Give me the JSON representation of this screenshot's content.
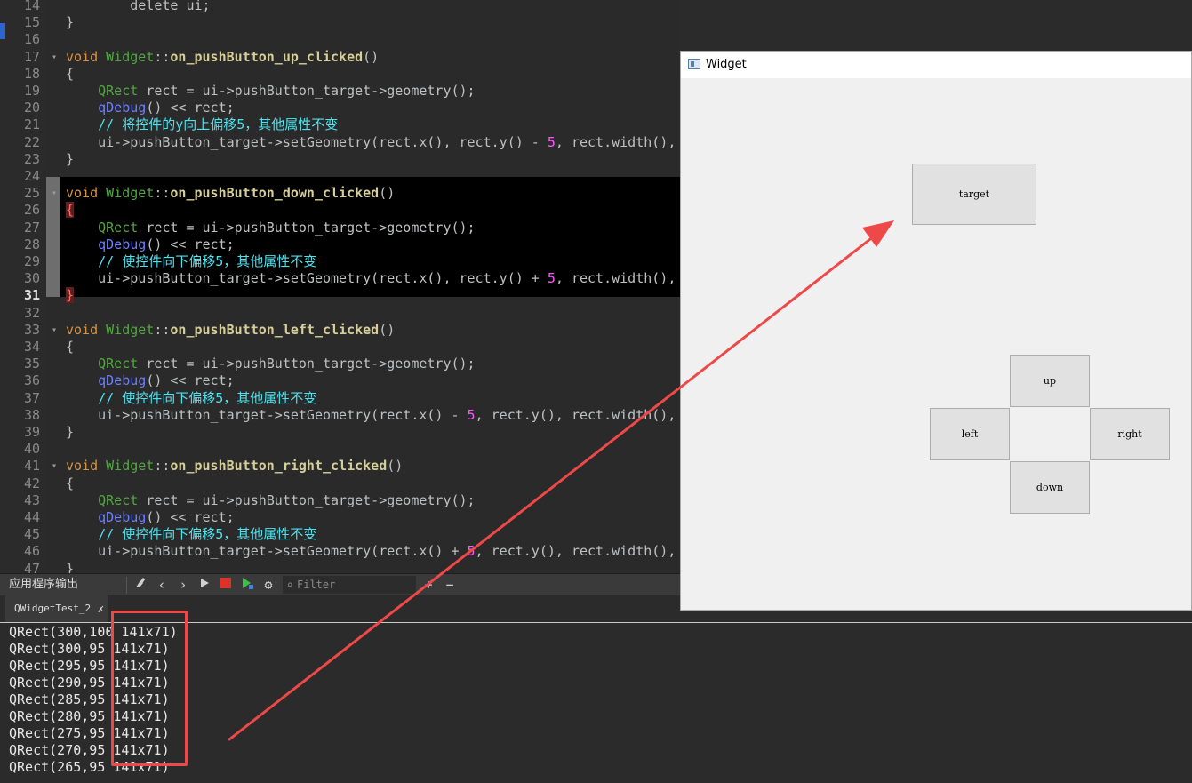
{
  "editor": {
    "lines": [
      {
        "n": "14",
        "fold": "",
        "html": "        <span class='pl'>delete ui;</span>"
      },
      {
        "n": "15",
        "fold": "",
        "html": "<span class='pl'>}</span>"
      },
      {
        "n": "16",
        "fold": "",
        "html": ""
      },
      {
        "n": "17",
        "fold": "▾",
        "html": "<span class='kw'>void</span> <span class='cls'>Widget</span><span class='pl'>::</span><span class='fn'>on_pushButton_up_clicked</span><span class='pl'>()</span>"
      },
      {
        "n": "18",
        "fold": "",
        "html": "<span class='pl'>{</span>"
      },
      {
        "n": "19",
        "fold": "",
        "html": "    <span class='type'>QRect</span> <span class='pl'>rect = ui-&gt;pushButton_target-&gt;geometry();</span>"
      },
      {
        "n": "20",
        "fold": "",
        "html": "    <span class='qd'>qDebug</span><span class='pl'>() &lt;&lt; rect;</span>"
      },
      {
        "n": "21",
        "fold": "",
        "html": "    <span class='cm'>// 将控件的y向上偏移5，其他属性不变</span>"
      },
      {
        "n": "22",
        "fold": "",
        "html": "    <span class='pl'>ui-&gt;pushButton_target-&gt;setGeometry(rect.x(), rect.y() - </span><span class='num'>5</span><span class='pl'>, rect.width(),</span>"
      },
      {
        "n": "23",
        "fold": "",
        "html": "<span class='pl'>}</span>"
      },
      {
        "n": "24",
        "fold": "",
        "html": ""
      },
      {
        "n": "25",
        "fold": "▾",
        "html": "<span class='kw'>void</span> <span class='cls'>Widget</span><span class='pl'>::</span><span class='fn'>on_pushButton_down_clicked</span><span class='pl'>()</span>"
      },
      {
        "n": "26",
        "fold": "",
        "html": "<span class='br-hl'>{</span>"
      },
      {
        "n": "27",
        "fold": "",
        "html": "    <span class='type'>QRect</span> <span class='pl'>rect = ui-&gt;pushButton_target-&gt;geometry();</span>"
      },
      {
        "n": "28",
        "fold": "",
        "html": "    <span class='qd'>qDebug</span><span class='pl'>() &lt;&lt; rect;</span>"
      },
      {
        "n": "29",
        "fold": "",
        "html": "    <span class='cm'>// 使控件向下偏移5，其他属性不变</span>"
      },
      {
        "n": "30",
        "fold": "",
        "html": "    <span class='pl'>ui-&gt;pushButton_target-&gt;setGeometry(rect.x(), rect.y() + </span><span class='num'>5</span><span class='pl'>, rect.width(),</span>"
      },
      {
        "n": "31",
        "fold": "",
        "cur": true,
        "html": "<span class='br-hl'>}</span>"
      },
      {
        "n": "32",
        "fold": "",
        "html": ""
      },
      {
        "n": "33",
        "fold": "▾",
        "html": "<span class='kw'>void</span> <span class='cls'>Widget</span><span class='pl'>::</span><span class='fn'>on_pushButton_left_clicked</span><span class='pl'>()</span>"
      },
      {
        "n": "34",
        "fold": "",
        "html": "<span class='pl'>{</span>"
      },
      {
        "n": "35",
        "fold": "",
        "html": "    <span class='type'>QRect</span> <span class='pl'>rect = ui-&gt;pushButton_target-&gt;geometry();</span>"
      },
      {
        "n": "36",
        "fold": "",
        "html": "    <span class='qd'>qDebug</span><span class='pl'>() &lt;&lt; rect;</span>"
      },
      {
        "n": "37",
        "fold": "",
        "html": "    <span class='cm'>// 使控件向下偏移5，其他属性不变</span>"
      },
      {
        "n": "38",
        "fold": "",
        "html": "    <span class='pl'>ui-&gt;pushButton_target-&gt;setGeometry(rect.x() - </span><span class='num'>5</span><span class='pl'>, rect.y(), rect.width(),</span>"
      },
      {
        "n": "39",
        "fold": "",
        "html": "<span class='pl'>}</span>"
      },
      {
        "n": "40",
        "fold": "",
        "html": ""
      },
      {
        "n": "41",
        "fold": "▾",
        "html": "<span class='kw'>void</span> <span class='cls'>Widget</span><span class='pl'>::</span><span class='fn'>on_pushButton_right_clicked</span><span class='pl'>()</span>"
      },
      {
        "n": "42",
        "fold": "",
        "html": "<span class='pl'>{</span>"
      },
      {
        "n": "43",
        "fold": "",
        "html": "    <span class='type'>QRect</span> <span class='pl'>rect = ui-&gt;pushButton_target-&gt;geometry();</span>"
      },
      {
        "n": "44",
        "fold": "",
        "html": "    <span class='qd'>qDebug</span><span class='pl'>() &lt;&lt; rect;</span>"
      },
      {
        "n": "45",
        "fold": "",
        "html": "    <span class='cm'>// 使控件向下偏移5，其他属性不变</span>"
      },
      {
        "n": "46",
        "fold": "",
        "html": "    <span class='pl'>ui-&gt;pushButton_target-&gt;setGeometry(rect.x() + </span><span class='num'>5</span><span class='pl'>, rect.y(), rect.width(),</span>"
      },
      {
        "n": "47",
        "fold": "",
        "html": "<span class='pl'>}</span>"
      }
    ]
  },
  "output": {
    "title": "应用程序输出",
    "filter_placeholder": "Filter",
    "tab_label": "QWidgetTest_2",
    "rows": [
      "QRect(300,100 141x71)",
      "QRect(300,95 141x71)",
      "QRect(295,95 141x71)",
      "QRect(290,95 141x71)",
      "QRect(285,95 141x71)",
      "QRect(280,95 141x71)",
      "QRect(275,95 141x71)",
      "QRect(270,95 141x71)",
      "QRect(265,95 141x71)"
    ]
  },
  "widget_window": {
    "title": "Widget",
    "buttons": {
      "target": "target",
      "up": "up",
      "left": "left",
      "right": "right",
      "down": "down"
    }
  },
  "annotation_color": "#ee4848"
}
